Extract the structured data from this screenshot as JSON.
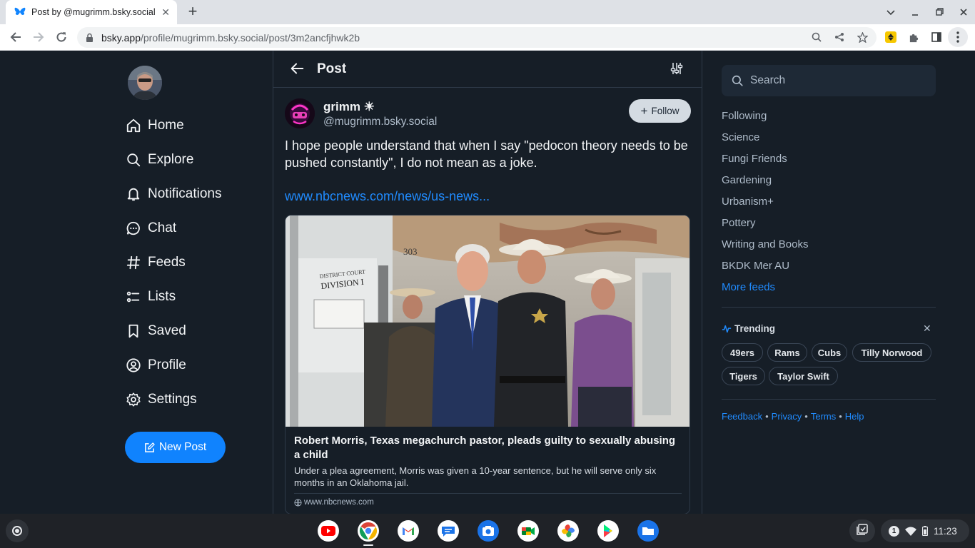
{
  "browser": {
    "tab_title": "Post by @mugrimm.bsky.social",
    "url_host": "bsky.app",
    "url_path": "/profile/mugrimm.bsky.social/post/3m2ancfjhwk2b"
  },
  "nav": {
    "items": [
      {
        "label": "Home",
        "icon": "home-icon"
      },
      {
        "label": "Explore",
        "icon": "search-icon"
      },
      {
        "label": "Notifications",
        "icon": "bell-icon"
      },
      {
        "label": "Chat",
        "icon": "chat-bubble-icon"
      },
      {
        "label": "Feeds",
        "icon": "hash-icon"
      },
      {
        "label": "Lists",
        "icon": "list-icon"
      },
      {
        "label": "Saved",
        "icon": "bookmark-icon"
      },
      {
        "label": "Profile",
        "icon": "user-circle-icon"
      },
      {
        "label": "Settings",
        "icon": "gear-icon"
      }
    ],
    "new_post": "New Post"
  },
  "post": {
    "header_title": "Post",
    "author_name": "grimm ☀",
    "author_handle": "@mugrimm.bsky.social",
    "follow_label": "Follow",
    "text": "I hope people understand that when I say \"pedocon theory needs to be pushed constantly\", I do not mean as a joke.",
    "link_text": "www.nbcnews.com/news/us-news...",
    "card": {
      "title": "Robert Morris, Texas megachurch pastor, pleads guilty to sexually abusing a child",
      "description": "Under a plea agreement, Morris was given a 10-year sentence, but he will serve only six months in an Oklahoma jail.",
      "domain": "www.nbcnews.com",
      "image_sign_1": "303",
      "image_sign_2": "DISTRICT COURT",
      "image_sign_3": "DIVISION I"
    }
  },
  "sidebar": {
    "search_placeholder": "Search",
    "feeds": [
      "Following",
      "Science",
      "Fungi Friends",
      "Gardening",
      "Urbanism+",
      "Pottery",
      "Writing and Books",
      "BKDK Mer AU"
    ],
    "more_feeds": "More feeds",
    "trending_title": "Trending",
    "trending": [
      "49ers",
      "Rams",
      "Cubs",
      "Tilly Norwood",
      "Tigers",
      "Taylor Swift"
    ],
    "footer": [
      "Feedback",
      "Privacy",
      "Terms",
      "Help"
    ]
  },
  "shelf": {
    "apps": [
      "youtube-icon",
      "chrome-icon",
      "gmail-icon",
      "messages-icon",
      "camera-icon",
      "meet-icon",
      "photos-icon",
      "play-store-icon",
      "files-icon"
    ],
    "notification_count": "1",
    "time": "11:23"
  },
  "colors": {
    "background": "#161e27",
    "accent": "#1083fe",
    "link": "#208bfe",
    "text_primary": "#f1f3f5",
    "text_secondary": "#aebbc9",
    "border": "#2e3a48"
  }
}
